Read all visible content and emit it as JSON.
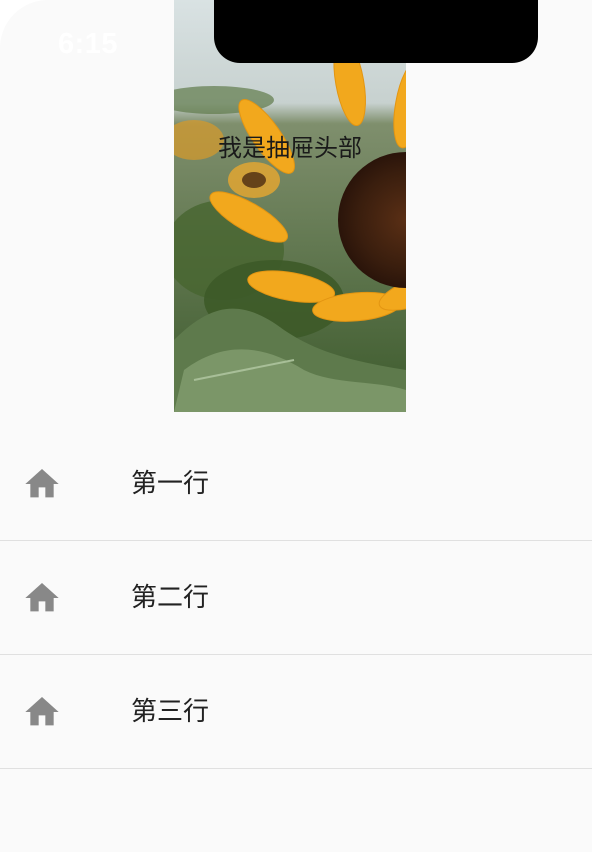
{
  "status_bar": {
    "time": "6:15"
  },
  "drawer": {
    "header_title": "我是抽屉头部",
    "header_image": "sunflower-photo",
    "items": [
      {
        "icon": "home-icon",
        "label": "第一行"
      },
      {
        "icon": "home-icon",
        "label": "第二行"
      },
      {
        "icon": "home-icon",
        "label": "第三行"
      }
    ]
  },
  "colors": {
    "background": "#fafafa",
    "icon": "#888888",
    "divider": "#e0e0e0",
    "text": "#222222"
  }
}
